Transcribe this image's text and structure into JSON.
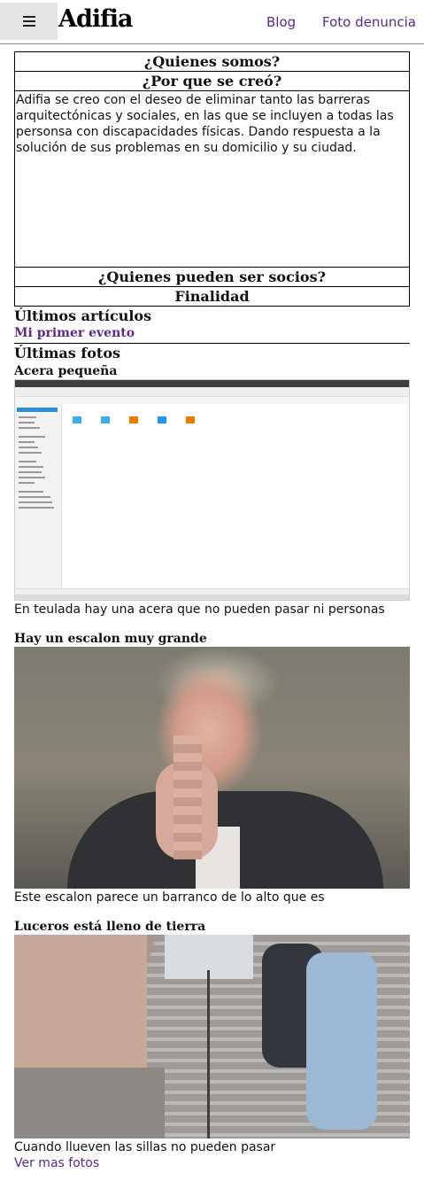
{
  "header": {
    "brand": "Adifia",
    "nav": {
      "blog": "Blog",
      "foto_denuncia": "Foto denuncia"
    }
  },
  "info": {
    "heading1": "¿Quienes somos?",
    "heading2": "¿Por que se creó?",
    "description": "Adifia se creo con el deseo de eliminar tanto las barreras arquitectónicas y sociales, en las que se incluyen a todas las personsa con discapacidades físicas. Dando respuesta a la solución de sus problemas en su domicilio y su ciudad.",
    "heading3": "¿Quienes pueden ser socios?",
    "heading4": "Finalidad"
  },
  "articles": {
    "title": "Últimos artículos",
    "items": [
      {
        "label": "Mi primer evento"
      }
    ]
  },
  "photos": {
    "title": "Últimas fotos",
    "items": [
      {
        "title": "Acera pequeña",
        "caption": "En teulada hay una acera que no pueden pasar ni personas"
      },
      {
        "title": "Hay un escalon muy grande",
        "caption": "Este escalon parece un barranco de lo alto que es"
      },
      {
        "title": "Luceros está lleno de tierra",
        "caption": "Cuando llueven las sillas no pueden pasar"
      }
    ],
    "more_label": "Ver mas fotos"
  },
  "colors": {
    "link": "#5b2a86",
    "menu_bg": "#e4e4e4"
  }
}
